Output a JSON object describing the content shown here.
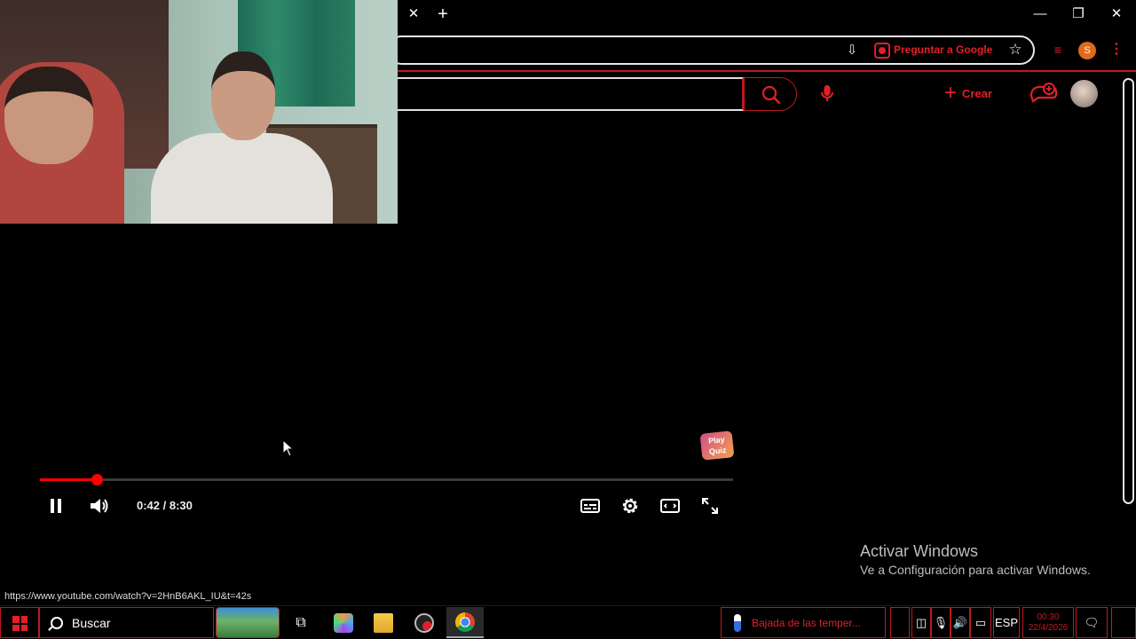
{
  "browser": {
    "tab_close": "✕",
    "tab_new": "+",
    "window_controls": {
      "minimize": "—",
      "restore": "❐",
      "close": "✕"
    },
    "ask_google": "Preguntar a Google",
    "profile_initial": "S",
    "status_url": "https://www.youtube.com/watch?v=2HnB6AKL_IU&t=42s"
  },
  "youtube": {
    "create_label": "Crear"
  },
  "player": {
    "time_display": "0:42 / 8:30",
    "progress": 0.082,
    "watermark_text": "Play Quiz"
  },
  "watermark_windows": {
    "title": "Activar Windows",
    "subtitle": "Ve a Configuración para activar Windows."
  },
  "taskbar": {
    "search_label": "Buscar",
    "weather_text": "Bajada de las temper...",
    "language": "ESP",
    "time": "00:30",
    "date": "22/4/2026"
  },
  "colors": {
    "accent": "#c0181f",
    "progress": "#ff0000"
  }
}
